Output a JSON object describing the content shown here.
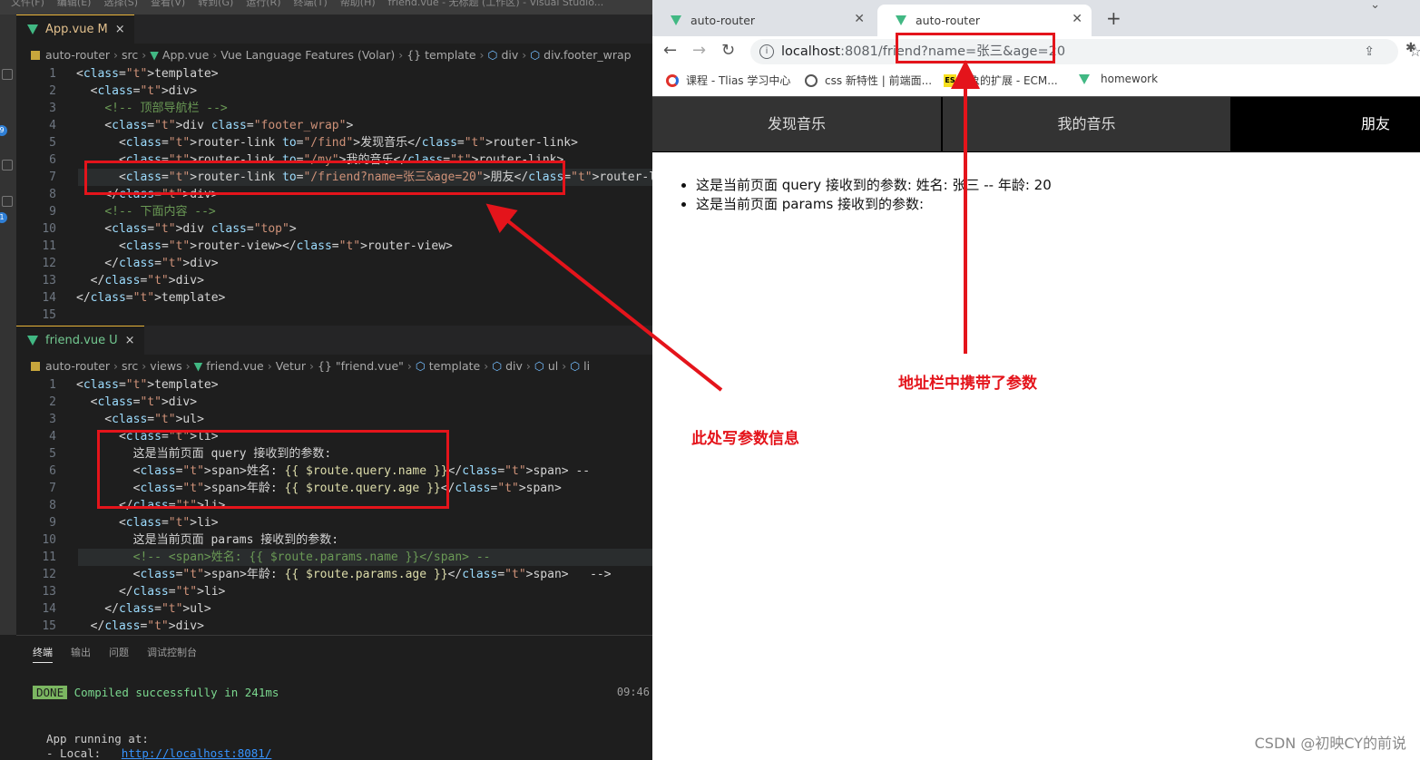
{
  "vscode": {
    "menu": [
      "文件(F)",
      "编辑(E)",
      "选择(S)",
      "查看(V)",
      "转到(G)",
      "运行(R)",
      "终端(T)",
      "帮助(H)",
      "friend.vue - 无标题 (工作区) - Visual Studio..."
    ],
    "badges": [
      "9",
      "1"
    ],
    "editor1": {
      "tab": {
        "name": "App.vue",
        "mark": "M",
        "close": "×"
      },
      "breadcrumb": [
        "auto-router",
        "src",
        "App.vue",
        "Vue Language Features (Volar)",
        "{} template",
        "div",
        "div.footer_wrap"
      ],
      "line_numbers": [
        "1",
        "2",
        "3",
        "4",
        "5",
        "6",
        "7",
        "8",
        "9",
        "10",
        "11",
        "12",
        "13",
        "14",
        "15"
      ],
      "lines": [
        "<template>",
        "  <div>",
        "    <!-- 顶部导航栏 -->",
        "    <div class=\"footer_wrap\">",
        "      <router-link to=\"/find\">发现音乐</router-link>",
        "      <router-link to=\"/my\">我的音乐</router-link>",
        "      <router-link to=\"/friend?name=张三&age=20\">朋友</router-link>",
        "    </div>",
        "    <!-- 下面内容 -->",
        "    <div class=\"top\">",
        "      <router-view></router-view>",
        "    </div>",
        "  </div>",
        "</template>",
        ""
      ]
    },
    "editor2": {
      "tab": {
        "name": "friend.vue",
        "mark": "U",
        "close": "×"
      },
      "breadcrumb": [
        "auto-router",
        "src",
        "views",
        "friend.vue",
        "Vetur",
        "{} \"friend.vue\"",
        "template",
        "div",
        "ul",
        "li"
      ],
      "line_numbers": [
        "1",
        "2",
        "3",
        "4",
        "5",
        "6",
        "7",
        "8",
        "9",
        "10",
        "11",
        "12",
        "13",
        "14",
        "15"
      ],
      "lines": [
        "<template>",
        "  <div>",
        "    <ul>",
        "      <li>",
        "        这是当前页面 query 接收到的参数:",
        "        <span>姓名: {{ $route.query.name }}</span> --",
        "        <span>年龄: {{ $route.query.age }}</span>",
        "      </li>",
        "      <li>",
        "        这是当前页面 params 接收到的参数:",
        "        <!-- <span>姓名: {{ $route.params.name }}</span> --",
        "        <span>年龄: {{ $route.params.age }}</span>   -->",
        "      </li>",
        "    </ul>",
        "  </div>"
      ]
    },
    "panel": {
      "tabs": [
        "终端",
        "输出",
        "问题",
        "调试控制台"
      ],
      "done_label": "DONE",
      "compiled": "Compiled successfully in 241ms",
      "time": "09:46",
      "running": "App running at:",
      "local_label": "- Local:   ",
      "local_url": "http://localhost:8081/"
    }
  },
  "browser": {
    "tabs": [
      {
        "title": "auto-router",
        "active": false
      },
      {
        "title": "auto-router",
        "active": true
      }
    ],
    "new_tab": "+",
    "url_host": "localhost",
    "url_rest": ":8081/friend?name=张三&age=20",
    "bookmarks": [
      "课程 - Tlias 学习中心",
      "css 新特性 | 前端面...",
      "对象的扩展 - ECM...",
      "homework"
    ],
    "bookmark_es": "ES",
    "nav": [
      "发现音乐",
      "我的音乐",
      "朋友"
    ],
    "content": [
      "这是当前页面 query 接收到的参数: 姓名: 张三 -- 年龄: 20",
      "这是当前页面 params 接收到的参数:"
    ]
  },
  "annotations": {
    "address": "地址栏中携带了参数",
    "params": "此处写参数信息"
  },
  "watermark": "CSDN @初映CY的前说",
  "colors": {
    "annotation_red": "#e4141b",
    "vue_green": "#41b883"
  }
}
